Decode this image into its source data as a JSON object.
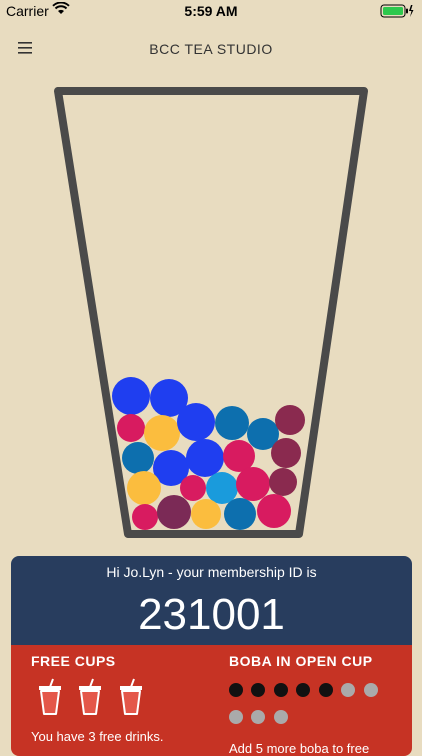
{
  "status_bar": {
    "carrier": "Carrier",
    "time": "5:59 AM",
    "wifi_icon": "wifi-icon",
    "battery_icon": "battery-charging-icon"
  },
  "nav": {
    "title": "BCC TEA STUDIO",
    "menu_icon": "hamburger-menu-icon"
  },
  "membership": {
    "greeting": "Hi Jo.Lyn - your membership ID is",
    "member_id": "231001"
  },
  "free_cups": {
    "heading": "FREE CUPS",
    "count": 3,
    "note": "You have 3 free drinks."
  },
  "boba": {
    "heading": "BOBA IN OPEN CUP",
    "filled": 5,
    "total": 10,
    "note": "Add 5 more boba to free"
  },
  "colors": {
    "background": "#e8dcc0",
    "card_top": "#283d5e",
    "card_bottom": "#c63324",
    "cup_outline": "#4a4a4a",
    "boba_palette": [
      "#1f3ef0",
      "#d81b60",
      "#0d6fae",
      "#fbbd3e",
      "#7b2a56",
      "#1a9bdc",
      "#8a2a4f"
    ]
  }
}
